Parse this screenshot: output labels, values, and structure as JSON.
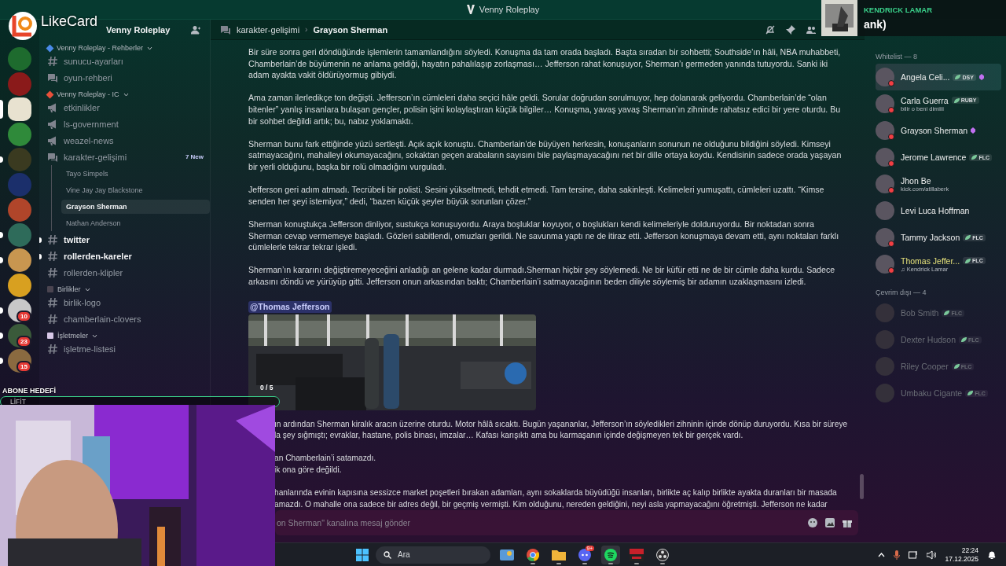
{
  "window": {
    "title": "Venny Roleplay"
  },
  "servers": [
    {
      "color": "#1e6b2e",
      "unread": false,
      "selected": false
    },
    {
      "color": "#8a1a1a",
      "unread": false,
      "selected": false
    },
    {
      "color": "#e8e2d0",
      "unread": false,
      "selected": true
    },
    {
      "color": "#2f8a3a",
      "unread": false,
      "selected": false
    },
    {
      "color": "#3a3a20",
      "unread": true,
      "selected": false
    },
    {
      "color": "#1b2f6b",
      "unread": false,
      "selected": false
    },
    {
      "color": "#b0452a",
      "unread": false,
      "selected": false
    },
    {
      "color": "#2e6b5a",
      "unread": true,
      "selected": false
    },
    {
      "color": "#c89650",
      "unread": true,
      "selected": false
    },
    {
      "color": "#d8a020",
      "unread": false,
      "selected": false
    },
    {
      "color": "#c8c8c8",
      "unread": true,
      "selected": false,
      "badge": "10"
    },
    {
      "color": "#3a5a3a",
      "unread": true,
      "selected": false,
      "badge": "23"
    },
    {
      "color": "#8a6a40",
      "unread": true,
      "selected": false,
      "badge": "15"
    }
  ],
  "sidebar": {
    "server_name": "Venny Roleplay",
    "categories": [
      {
        "name": "Venny Roleplay - Rehberler",
        "color": "#4a8ae8",
        "channels": [
          {
            "kind": "text",
            "name": "sunucu-ayarları",
            "unread": false
          },
          {
            "kind": "forum",
            "name": "oyun-rehberi",
            "unread": false
          }
        ]
      },
      {
        "name": "Venny Roleplay - IC",
        "color": "#e8503a",
        "channels": [
          {
            "kind": "announcement",
            "name": "etkinlikler",
            "unread": false
          },
          {
            "kind": "announcement",
            "name": "ls-government",
            "unread": false
          },
          {
            "kind": "announcement",
            "name": "weazel-news",
            "unread": false
          },
          {
            "kind": "forum",
            "name": "karakter-gelişimi",
            "unread": false,
            "badge": "7 New",
            "threads": [
              {
                "name": "Tayo Simpels",
                "selected": false
              },
              {
                "name": "Vine Jay Jay Blackstone",
                "selected": false
              },
              {
                "name": "Grayson Sherman",
                "selected": true
              },
              {
                "name": "Nathan Anderson",
                "selected": false
              }
            ]
          },
          {
            "kind": "text",
            "name": "twitter",
            "unread": true
          },
          {
            "kind": "text",
            "name": "rollerden-kareler",
            "unread": true
          },
          {
            "kind": "text",
            "name": "rollerden-klipler",
            "unread": false
          }
        ]
      },
      {
        "name": "Birlikler",
        "color": "#4a4450",
        "channels": [
          {
            "kind": "text",
            "name": "birlik-logo",
            "unread": false
          },
          {
            "kind": "text",
            "name": "chamberlain-clovers",
            "unread": false
          }
        ]
      },
      {
        "name": "İşletmeler",
        "color": "#d8c8e8",
        "channels": [
          {
            "kind": "text",
            "name": "işletme-listesi",
            "unread": false
          }
        ]
      }
    ]
  },
  "header": {
    "channel": "karakter-gelişimi",
    "separator": "›",
    "thread": "Grayson Sherman"
  },
  "messages": {
    "paragraphs": [
      "Bir süre sonra geri döndüğünde işlemlerin tamamlandığını söyledi. Konuşma da tam orada başladı. Başta sıradan bir sohbetti; Southside’ın hâli, NBA muhabbeti, Chamberlain’de büyümenin ne anlama geldiği, hayatın pahalılaşıp zorlaşması… Jefferson rahat konuşuyor, Sherman’ı germeden yanında tutuyordu. Sanki iki adam ayakta vakit öldürüyormuş gibiydi.",
      "Ama zaman ilerledikçe ton değişti. Jefferson’ın cümleleri daha seçici hâle geldi. Sorular doğrudan sorulmuyor, hep dolanarak geliyordu. Chamberlain’de “olan bitenler” yanlış insanlara bulaşan gençler, polisin işini kolaylaştıran küçük bilgiler… Konuşma, yavaş yavaş Sherman’ın zihninde rahatsız edici bir yere oturdu. Bu bir sohbet değildi artık; bu, nabız yoklamaktı.",
      "Sherman bunu fark ettiğinde yüzü sertleşti. Açık açık konuştu. Chamberlain’de büyüyen herkesin, konuşanların sonunun ne olduğunu bildiğini söyledi. Kimseyi satmayacağını, mahalleyi okumayacağını, sokaktan geçen arabaların sayısını bile paylaşmayacağını net bir dille ortaya koydu. Kendisinin sadece orada yaşayan bir yerli olduğunu, başka bir rolü olmadığını vurguladı.",
      "Jefferson geri adım atmadı. Tecrübeli bir polisti. Sesini yükseltmedi, tehdit etmedi. Tam tersine, daha sakinleşti. Kelimeleri yumuşattı, cümleleri uzattı. “Kimse senden her şeyi istemiyor,” dedi, “bazen küçük şeyler büyük sorunları çözer.”",
      "Sherman konuştukça Jefferson dinliyor, sustukça konuşuyordu. Araya boşluklar koyuyor, o boşlukları kendi kelimeleriyle dolduruyordu. Bir noktadan sonra Sherman cevap vermemeye başladı. Gözleri sabitlendi, omuzları gerildi. Ne savunma yaptı ne de itiraz etti. Jefferson konuşmaya devam etti, aynı noktaları farklı cümlelerle tekrar tekrar işledi.",
      "Sherman’ın kararını değiştiremeyeceğini anladığı an gelene kadar durmadı.Sherman hiçbir şey söylemedi. Ne bir küfür etti ne de bir cümle daha kurdu. Sadece arkasını döndü ve yürüyüp gitti. Jefferson onun arkasından baktı; Chamberlain’i satmayacağının beden diliyle söylemiş bir adamın uzaklaşmasını izledi."
    ],
    "mention": "@Thomas Jefferson",
    "attachment": {
      "kind": "picture"
    },
    "later_blocks": [
      [
        "ın ardından Sherman kiralık aracın üzerine oturdu. Motor hâlâ sıcaktı. Bugün yaşananlar, Jefferson’ın söyledikleri zihninin içinde dönüp duruyordu. Kısa bir süreye",
        "la şey sığmıştı; evraklar, hastane, polis binası, imzalar… Kafası karışıktı ama bu karmaşanın içinde değişmeyen tek bir gerçek vardı."
      ],
      [
        "an Chamberlain’i satamazdı.",
        "ik ona göre değildi."
      ],
      [
        "hanlarında evinin kapısına sessizce market poşetleri bırakan adamları, aynı sokaklarda büyüdüğü insanları, birlikte aç kalıp birlikte ayakta duranları bir masada",
        "amazdı. O mahalle ona sadece bir adres değil, bir geçmiş vermişti. Kim olduğunu, nereden geldiğini, neyi asla yapmayacağını öğretmişti. Jefferson ne kadar"
      ]
    ]
  },
  "composer": {
    "placeholder": "on Sherman\" kanalına mesaj gönder"
  },
  "members": {
    "groups": [
      {
        "title": "Whitelist — 8",
        "members": [
          {
            "name": "Angela Celi...",
            "tag": "DSY",
            "booster": true,
            "dnd": true,
            "offline": false,
            "nameplate": true,
            "color": "#f0f0f0"
          },
          {
            "name": "Carla Guerra",
            "tag": "RUBY",
            "booster": false,
            "dnd": true,
            "offline": false,
            "status": "bilir o beni dimiiii",
            "color": "#f0f0f0"
          },
          {
            "name": "Grayson Sherman",
            "booster": true,
            "dnd": true,
            "offline": false,
            "color": "#f0f0f0"
          },
          {
            "name": "Jerome Lawrence",
            "tag": "FLC",
            "booster": false,
            "dnd": true,
            "offline": false,
            "color": "#f0f0f0"
          },
          {
            "name": "Jhon Be",
            "booster": false,
            "dnd": true,
            "offline": false,
            "status": "kick.com/atillaberk",
            "color": "#f0f0f0"
          },
          {
            "name": "Levi Luca Hoffman",
            "booster": false,
            "dnd": false,
            "offline": false,
            "color": "#f0f0f0"
          },
          {
            "name": "Tammy Jackson",
            "tag": "FLC",
            "booster": false,
            "dnd": true,
            "offline": false,
            "color": "#f0f0f0"
          },
          {
            "name": "Thomas Jeffer...",
            "tag": "FLC",
            "booster": false,
            "dnd": true,
            "offline": false,
            "status": "♫ Kendrick Lamar",
            "color": "#e6e27a"
          }
        ]
      },
      {
        "title": "Çevrim dışı — 4",
        "members": [
          {
            "name": "Bob Smith",
            "tag": "FLC",
            "booster": false,
            "dnd": false,
            "offline": true
          },
          {
            "name": "Dexter Hudson",
            "tag": "FLC",
            "booster": false,
            "dnd": false,
            "offline": true
          },
          {
            "name": "Riley Cooper",
            "tag": "FLC",
            "booster": false,
            "dnd": false,
            "offline": true
          },
          {
            "name": "Umbaku Cigante",
            "tag": "FLC",
            "booster": false,
            "dnd": false,
            "offline": true
          }
        ]
      }
    ]
  },
  "taskbar": {
    "search_placeholder": "Ara",
    "apps": [
      {
        "kind": "widgets",
        "running": false,
        "selected": false
      },
      {
        "kind": "chrome",
        "running": true,
        "selected": false
      },
      {
        "kind": "folder",
        "running": true,
        "selected": false
      },
      {
        "kind": "discord",
        "running": true,
        "selected": false,
        "badge": "9+"
      },
      {
        "kind": "spotify",
        "running": true,
        "selected": true
      },
      {
        "kind": "voicemeeter",
        "running": true,
        "selected": false
      },
      {
        "kind": "obs",
        "running": true,
        "selected": false
      }
    ],
    "time": "22:24",
    "date": "17.12.2025"
  },
  "overlay": {
    "brand": "LikeCard",
    "goal_title": "ABONE HEDEFİ",
    "goal_name": "LİFİT",
    "goal_count": "0 / 5",
    "goal": {
      "level": 0
    },
    "now_playing_artist": "KENDRICK LAMAR",
    "now_playing_title": "ank)"
  }
}
